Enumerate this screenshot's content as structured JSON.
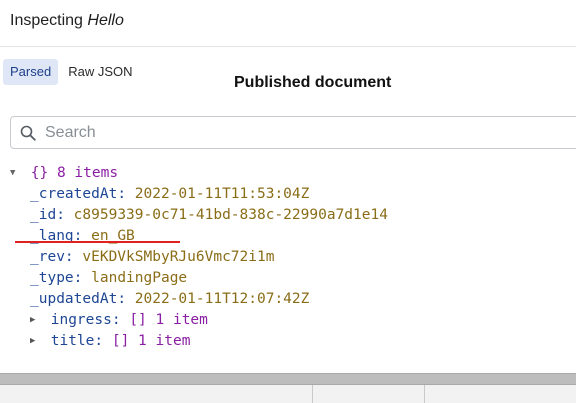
{
  "header": {
    "title_prefix": "Inspecting",
    "document_name": "Hello"
  },
  "tabs": [
    {
      "label": "Parsed",
      "active": true
    },
    {
      "label": "Raw JSON",
      "active": false
    }
  ],
  "published_label": "Published document",
  "search": {
    "placeholder": "Search",
    "value": ""
  },
  "tree": {
    "root": {
      "braces": "{}",
      "count_label": "8 items"
    },
    "fields": [
      {
        "key": "_createdAt",
        "value": "2022-01-11T11:53:04Z",
        "type": "string"
      },
      {
        "key": "_id",
        "value": "c8959339-0c71-41bd-838c-22990a7d1e14",
        "type": "string"
      },
      {
        "key": "_lang",
        "value": "en_GB",
        "type": "string"
      },
      {
        "key": "_rev",
        "value": "vEKDVkSMbyRJu6Vmc72i1m",
        "type": "string"
      },
      {
        "key": "_type",
        "value": "landingPage",
        "type": "string"
      },
      {
        "key": "_updatedAt",
        "value": "2022-01-11T12:07:42Z",
        "type": "string"
      },
      {
        "key": "ingress",
        "value": "[] 1 item",
        "type": "array"
      },
      {
        "key": "title",
        "value": "[] 1 item",
        "type": "array"
      }
    ]
  },
  "colors": {
    "key": "#1e4694",
    "string_value": "#8a6d17",
    "meta": "#8a1fa3",
    "annotation_underline": "#e0211f",
    "active_tab_bg": "#dfe7f7"
  }
}
